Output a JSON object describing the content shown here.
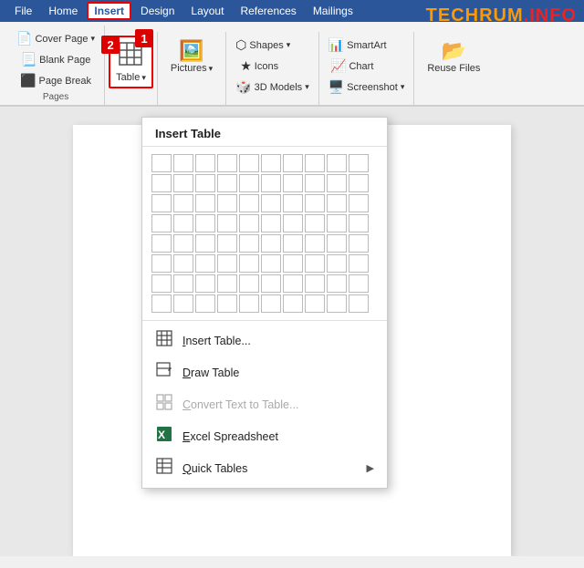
{
  "menubar": {
    "items": [
      "File",
      "Home",
      "Insert",
      "Design",
      "Layout",
      "References",
      "Mailings"
    ],
    "active_index": 2
  },
  "ribbon": {
    "groups": [
      {
        "label": "Pages",
        "items": [
          {
            "label": "Cover Page",
            "has_arrow": true
          },
          {
            "label": "Blank Page"
          },
          {
            "label": "Page Break"
          }
        ]
      },
      {
        "label": "",
        "items": [
          {
            "label": "Table",
            "is_active": true
          }
        ]
      },
      {
        "label": "",
        "items": [
          {
            "label": "Pictures",
            "has_arrow": true
          }
        ]
      },
      {
        "label": "",
        "items": [
          {
            "label": "Shapes",
            "has_arrow": true
          },
          {
            "label": "Icons"
          },
          {
            "label": "3D Models",
            "has_arrow": true
          }
        ]
      },
      {
        "label": "",
        "items": [
          {
            "label": "SmartArt"
          },
          {
            "label": "Chart"
          },
          {
            "label": "Screenshot",
            "has_arrow": true
          }
        ]
      },
      {
        "label": "Reuse Files",
        "items": []
      }
    ]
  },
  "dropdown": {
    "title": "Insert Table",
    "grid_rows": 8,
    "grid_cols": 10,
    "menu_items": [
      {
        "label": "Insert Table...",
        "icon": "⊞",
        "underline": "I",
        "disabled": false,
        "has_arrow": false
      },
      {
        "label": "Draw Table",
        "icon": "✏",
        "underline": "D",
        "disabled": false,
        "has_arrow": false
      },
      {
        "label": "Convert Text to Table...",
        "icon": "⊠",
        "underline": "C",
        "disabled": true,
        "has_arrow": false
      },
      {
        "label": "Excel Spreadsheet",
        "icon": "⊞",
        "underline": "E",
        "disabled": false,
        "has_arrow": false
      },
      {
        "label": "Quick Tables",
        "icon": "⊞",
        "underline": "Q",
        "disabled": false,
        "has_arrow": true
      }
    ]
  },
  "watermark": {
    "text1": "TECHRUM",
    "text2": ".INFO"
  },
  "badges": {
    "one": "1",
    "two": "2"
  },
  "doc": {
    "page_content": ""
  }
}
